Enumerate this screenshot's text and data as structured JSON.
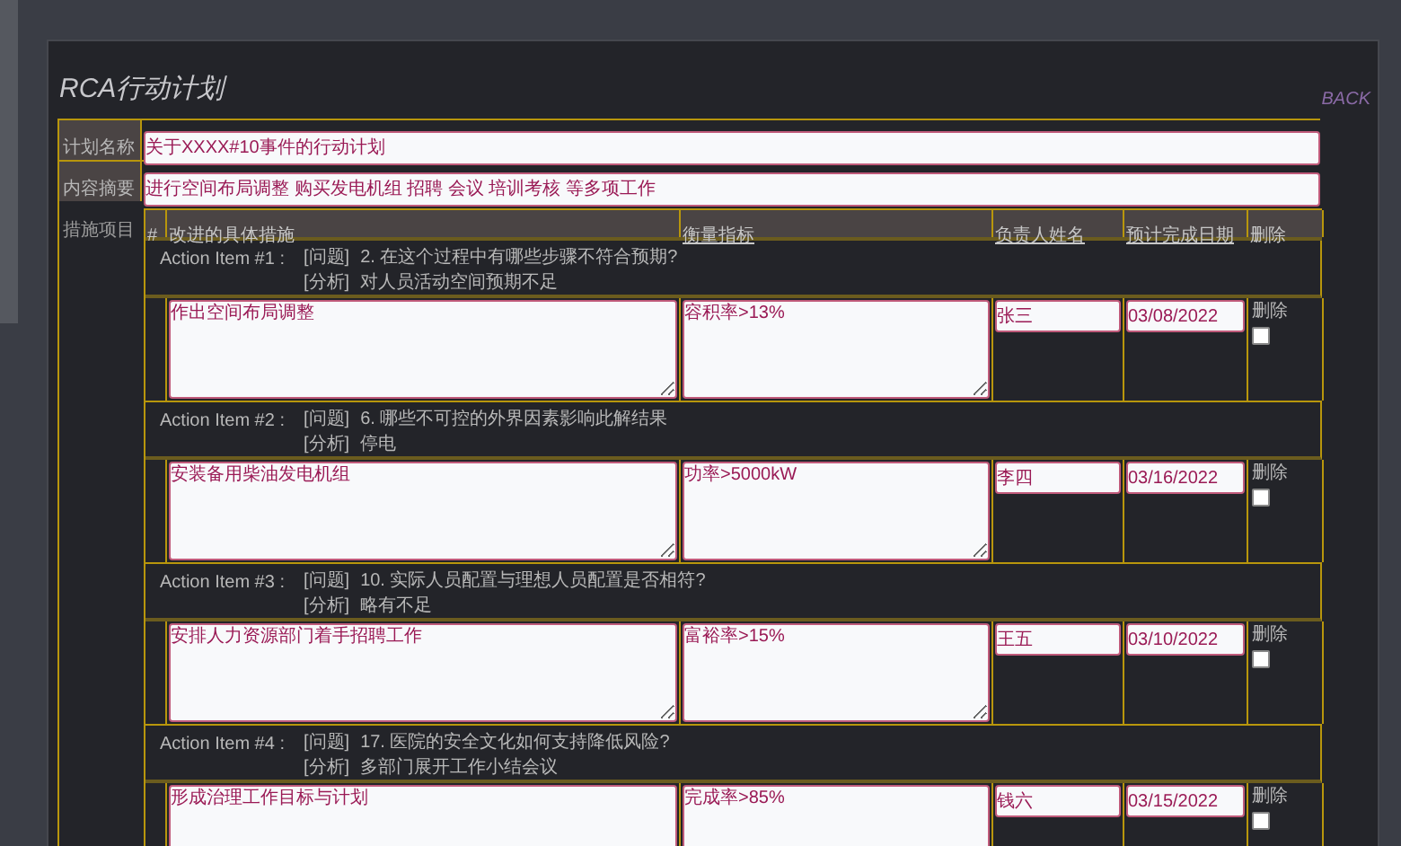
{
  "title": "RCA行动计划",
  "back_link": "BACK",
  "fields": [
    {
      "label": "计划名称",
      "value": "关于XXXX#10事件的行动计划"
    },
    {
      "label": "内容摘要",
      "value": "进行空间布局调整 购买发电机组 招聘 会议 培训考核 等多项工作"
    }
  ],
  "measures": {
    "label": "措施项目",
    "columns": [
      {
        "label": "#",
        "underlined": false
      },
      {
        "label": "改进的具体措施",
        "underlined": false
      },
      {
        "label": "衡量指标",
        "underlined": true
      },
      {
        "label": "负责人姓名",
        "underlined": true
      },
      {
        "label": "预计完成日期",
        "underlined": true
      },
      {
        "label": "删除",
        "underlined": false
      }
    ],
    "items": [
      {
        "heading": "Action Item #1 :",
        "problem_tag": "[问题]",
        "problem": "2. 在这个过程中有哪些步骤不符合预期?",
        "analysis_tag": "[分析]",
        "analysis": "对人员活动空间预期不足",
        "measure": "作出空间布局调整",
        "metric": "容积率>13%",
        "owner": "张三",
        "due": "03/08/2022",
        "delete_label": "删除",
        "delete_checked": false
      },
      {
        "heading": "Action Item #2 :",
        "problem_tag": "[问题]",
        "problem": "6. 哪些不可控的外界因素影响此解结果",
        "analysis_tag": "[分析]",
        "analysis": "停电",
        "measure": "安装备用柴油发电机组",
        "metric": "功率>5000kW",
        "owner": "李四",
        "due": "03/16/2022",
        "delete_label": "删除",
        "delete_checked": false
      },
      {
        "heading": "Action Item #3 :",
        "problem_tag": "[问题]",
        "problem": "10. 实际人员配置与理想人员配置是否相符?",
        "analysis_tag": "[分析]",
        "analysis": "略有不足",
        "measure": "安排人力资源部门着手招聘工作",
        "metric": "富裕率>15%",
        "owner": "王五",
        "due": "03/10/2022",
        "delete_label": "删除",
        "delete_checked": false
      },
      {
        "heading": "Action Item #4 :",
        "problem_tag": "[问题]",
        "problem": "17. 医院的安全文化如何支持降低风险?",
        "analysis_tag": "[分析]",
        "analysis": "多部门展开工作小结会议",
        "measure": "形成治理工作目标与计划",
        "metric": "完成率>85%",
        "owner": "钱六",
        "due": "03/15/2022",
        "delete_label": "删除",
        "delete_checked": false
      }
    ]
  }
}
